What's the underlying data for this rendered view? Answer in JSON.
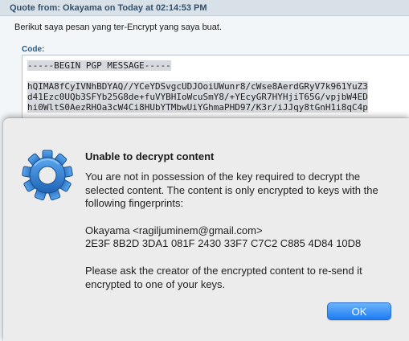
{
  "quote": {
    "header": "Quote from: Okayama on Today at 02:14:53 PM",
    "body": "Berikut saya pesan yang ter-Encrypt yang saya buat.",
    "code_label": "Code:",
    "code_lines": [
      "-----BEGIN PGP MESSAGE-----",
      "hQIMA8fCyIVNhBDYAQ//YCeYDSvgcUDJOoiUWunr8/cWse8AerdGRyV7k961YuZ3",
      "d41Ezc0UQb3SFYb25G8de+fuVYBHIoWcuSmY8/+YEcyGR7HYHjiT65G/vpjbW4ED",
      "hi0WltS0AezRHOa3cW4Ci8HUbYTMbwUiYGhmaPHD97/K3r/iJJqy8tGnH1i8qC4p"
    ]
  },
  "dialog": {
    "title": "Unable to decrypt content",
    "message_1": "You are not in possession of the key required to decrypt the selected content. The content is only encrypted to keys with the following fingerprints:",
    "fingerprint_owner": "Okayama <ragiljuminem@gmail.com>",
    "fingerprint": "2E3F 8B2D 3DA1 081F 2430  33F7 C7C2 C885 4D84 10D8",
    "message_2": "Please ask the creator of the encrypted content to re-send it encrypted to one of your keys.",
    "ok_label": "OK",
    "icon": "gear-icon"
  },
  "colors": {
    "accent": "#1d7cf2",
    "icon_blue": "#2f7fd0",
    "quote_header": "#35506b"
  }
}
